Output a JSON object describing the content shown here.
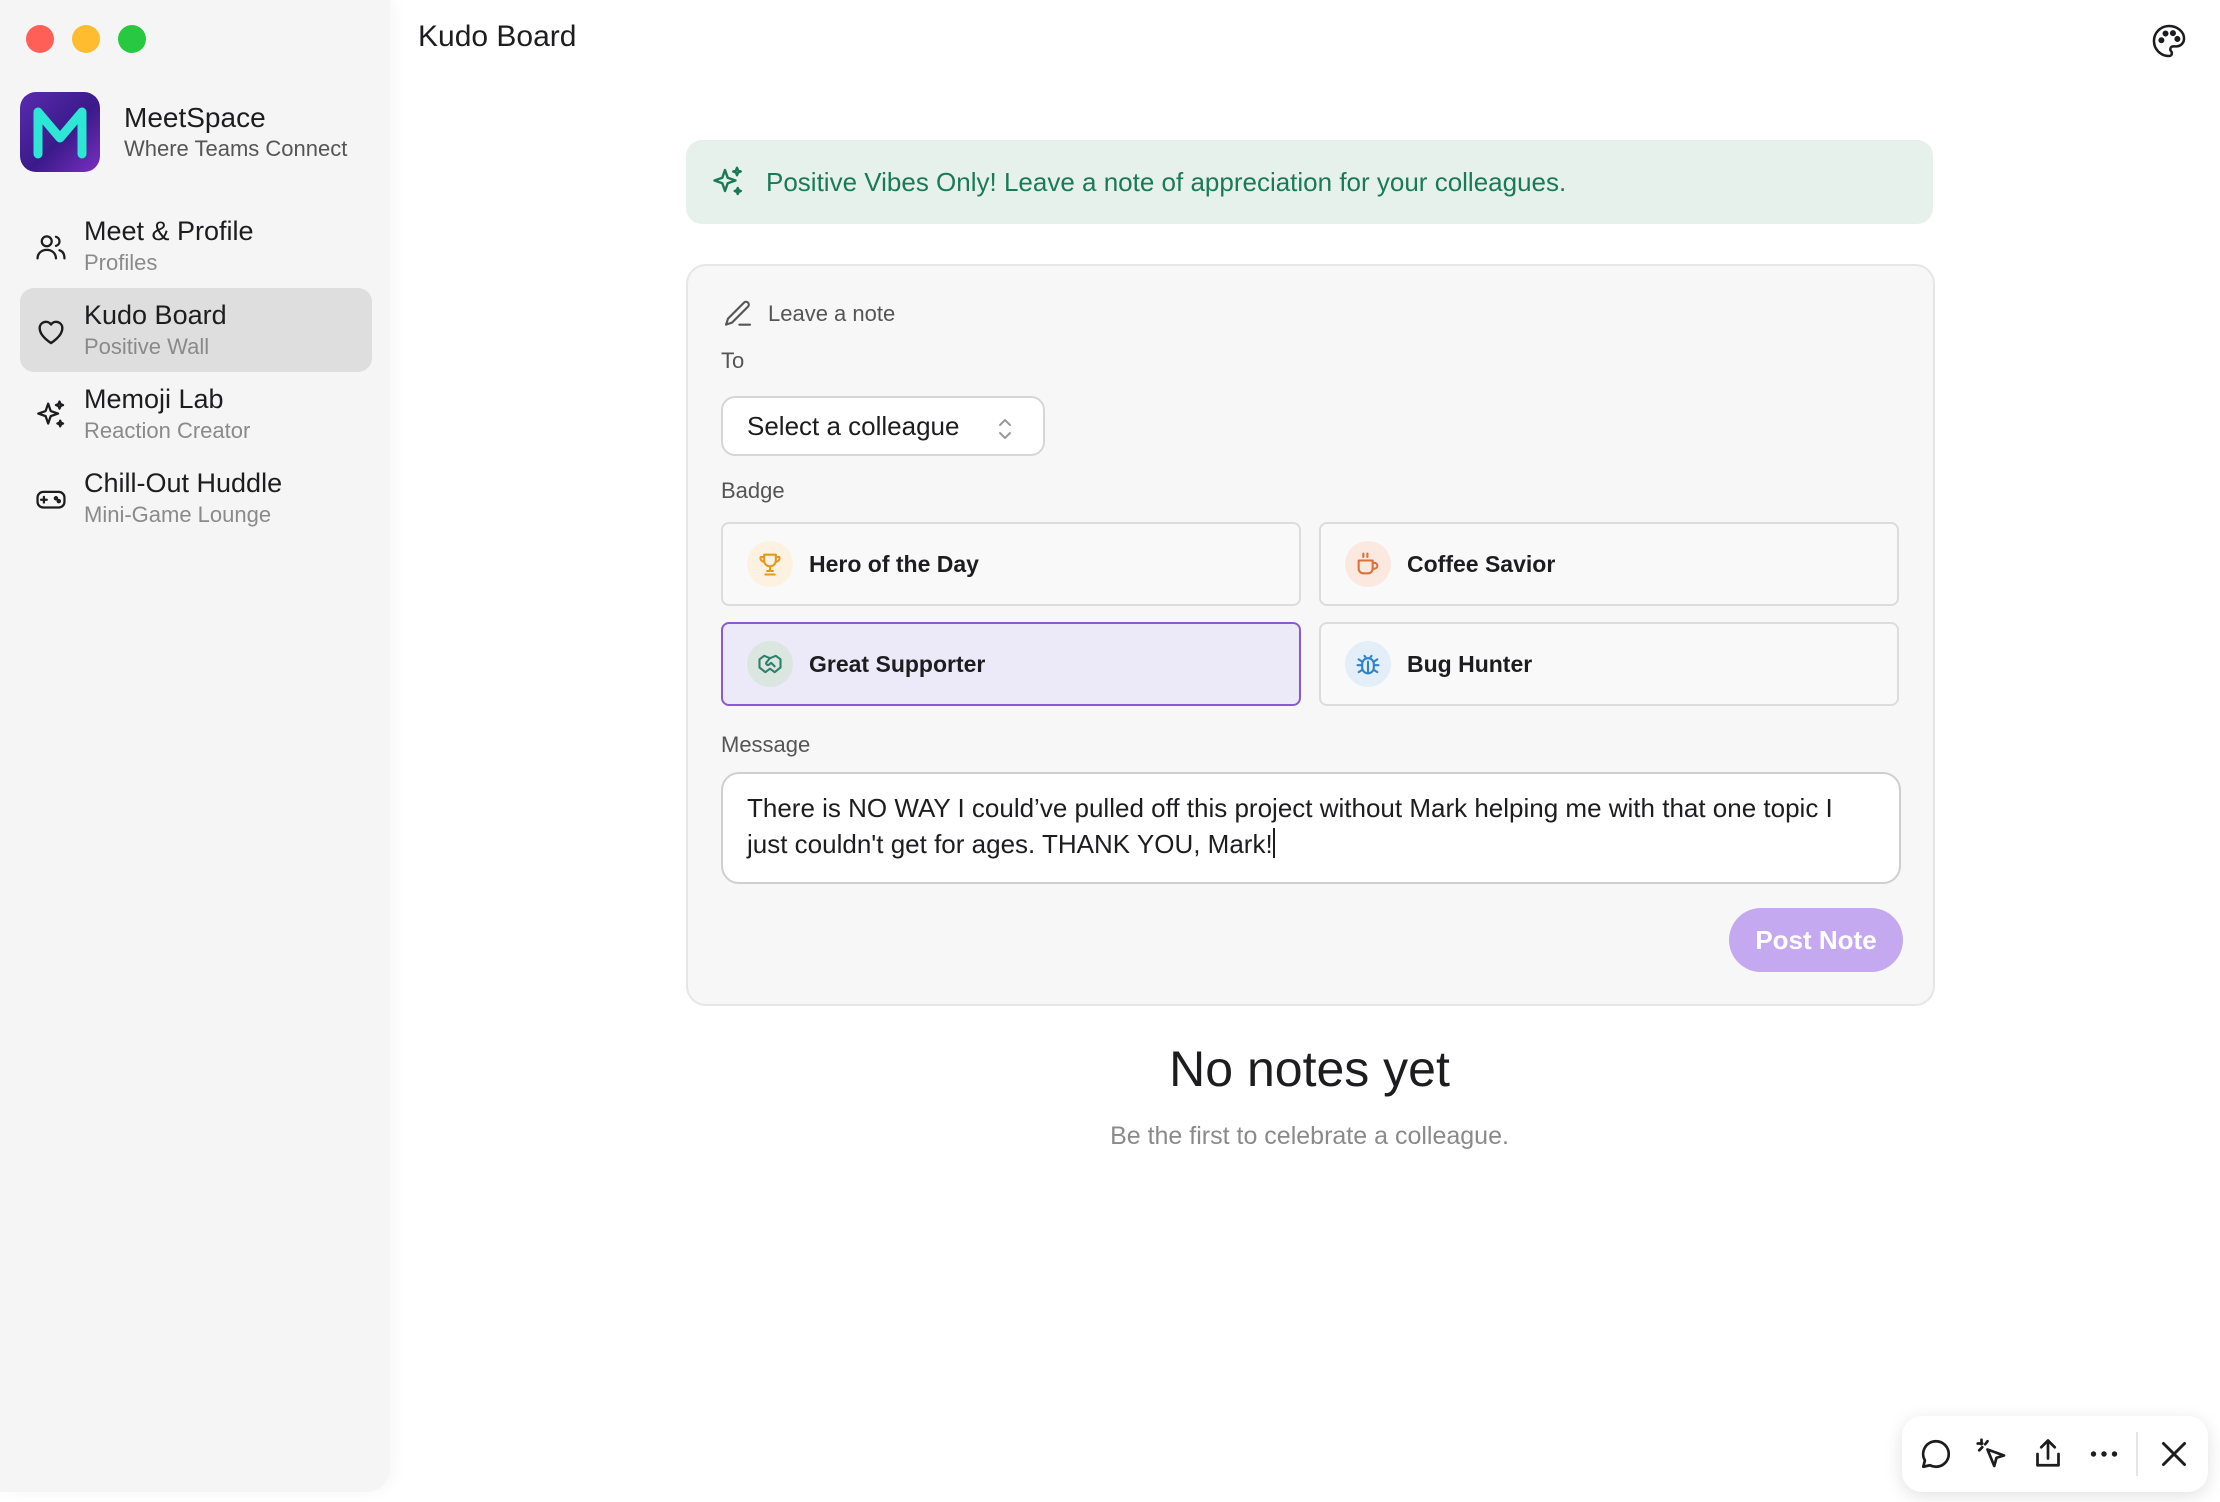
{
  "window": {
    "title": "Kudo Board"
  },
  "brand": {
    "name": "MeetSpace",
    "tagline": "Where Teams Connect",
    "logo_letter": "M"
  },
  "sidebar": {
    "items": [
      {
        "title": "Meet & Profile",
        "subtitle": "Profiles",
        "icon": "users-icon",
        "active": false
      },
      {
        "title": "Kudo Board",
        "subtitle": "Positive Wall",
        "icon": "heart-icon",
        "active": true
      },
      {
        "title": "Memoji Lab",
        "subtitle": "Reaction Creator",
        "icon": "sparkles-icon",
        "active": false
      },
      {
        "title": "Chill-Out Huddle",
        "subtitle": "Mini-Game Lounge",
        "icon": "gamepad-icon",
        "active": false
      }
    ]
  },
  "banner": {
    "text": "Positive Vibes Only! Leave a note of appreciation for your colleagues.",
    "icon": "sparkles-icon",
    "color": "#1a7a55"
  },
  "form": {
    "heading": "Leave a note",
    "to_label": "To",
    "to_value": "Select a colleague",
    "badge_label": "Badge",
    "badges": [
      {
        "label": "Hero of the Day",
        "icon": "trophy-icon",
        "selected": false
      },
      {
        "label": "Coffee Savior",
        "icon": "coffee-icon",
        "selected": false
      },
      {
        "label": "Great Supporter",
        "icon": "handshake-icon",
        "selected": true
      },
      {
        "label": "Bug Hunter",
        "icon": "bug-icon",
        "selected": false
      }
    ],
    "message_label": "Message",
    "message_value": "There is NO WAY I could’ve pulled off this project without Mark helping me with that one topic I just couldn't get for ages. THANK YOU, Mark!",
    "post_label": "Post Note"
  },
  "empty_state": {
    "title": "No notes yet",
    "subtitle": "Be the first to celebrate a colleague."
  },
  "colors": {
    "accent": "#8a59d6",
    "post_button": "#c4a8f0",
    "banner_bg": "#e7f1ec"
  },
  "toolbar": {
    "icons": [
      "chat-icon",
      "pointer-icon",
      "share-icon",
      "more-icon",
      "close-icon"
    ]
  }
}
